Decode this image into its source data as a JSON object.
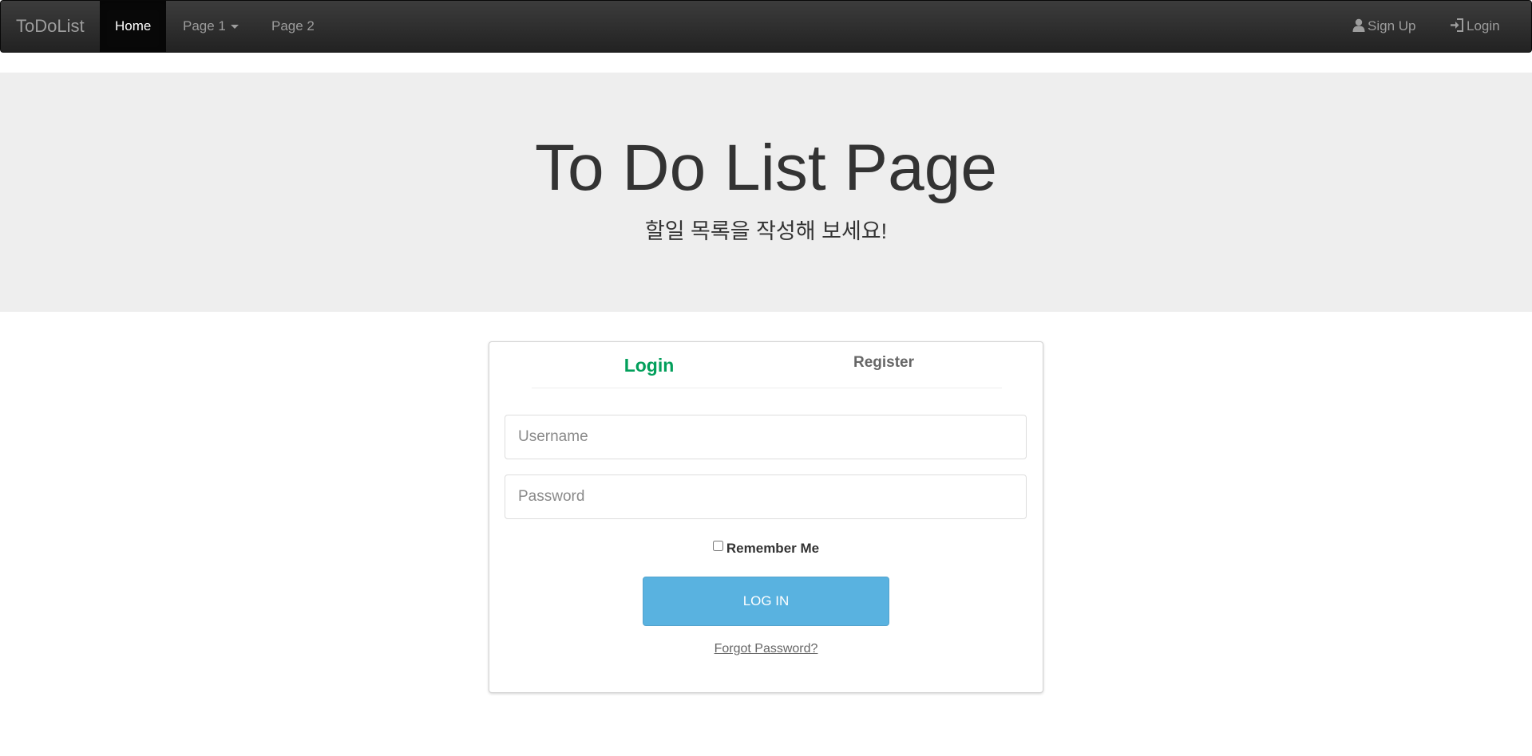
{
  "navbar": {
    "brand": "ToDoList",
    "items": [
      {
        "label": "Home",
        "active": true
      },
      {
        "label": "Page 1",
        "has_dropdown": true
      },
      {
        "label": "Page 2"
      }
    ],
    "right_items": [
      {
        "label": "Sign Up",
        "icon": "user-icon"
      },
      {
        "label": "Login",
        "icon": "log-in-icon"
      }
    ]
  },
  "jumbotron": {
    "title": "To Do List Page",
    "subtitle": "할일 목록을 작성해 보세요!"
  },
  "login_panel": {
    "tabs": [
      {
        "label": "Login",
        "active": true
      },
      {
        "label": "Register",
        "active": false
      }
    ],
    "username": {
      "value": "",
      "placeholder": "Username"
    },
    "password": {
      "value": "",
      "placeholder": "Password"
    },
    "remember_label": "Remember Me",
    "remember_checked": false,
    "submit_label": "LOG IN",
    "forgot_label": "Forgot Password?"
  },
  "colors": {
    "navbar_bg": "#222222",
    "jumbotron_bg": "#eeeeee",
    "active_tab": "#029f5b",
    "button_bg": "#59b2e0"
  }
}
